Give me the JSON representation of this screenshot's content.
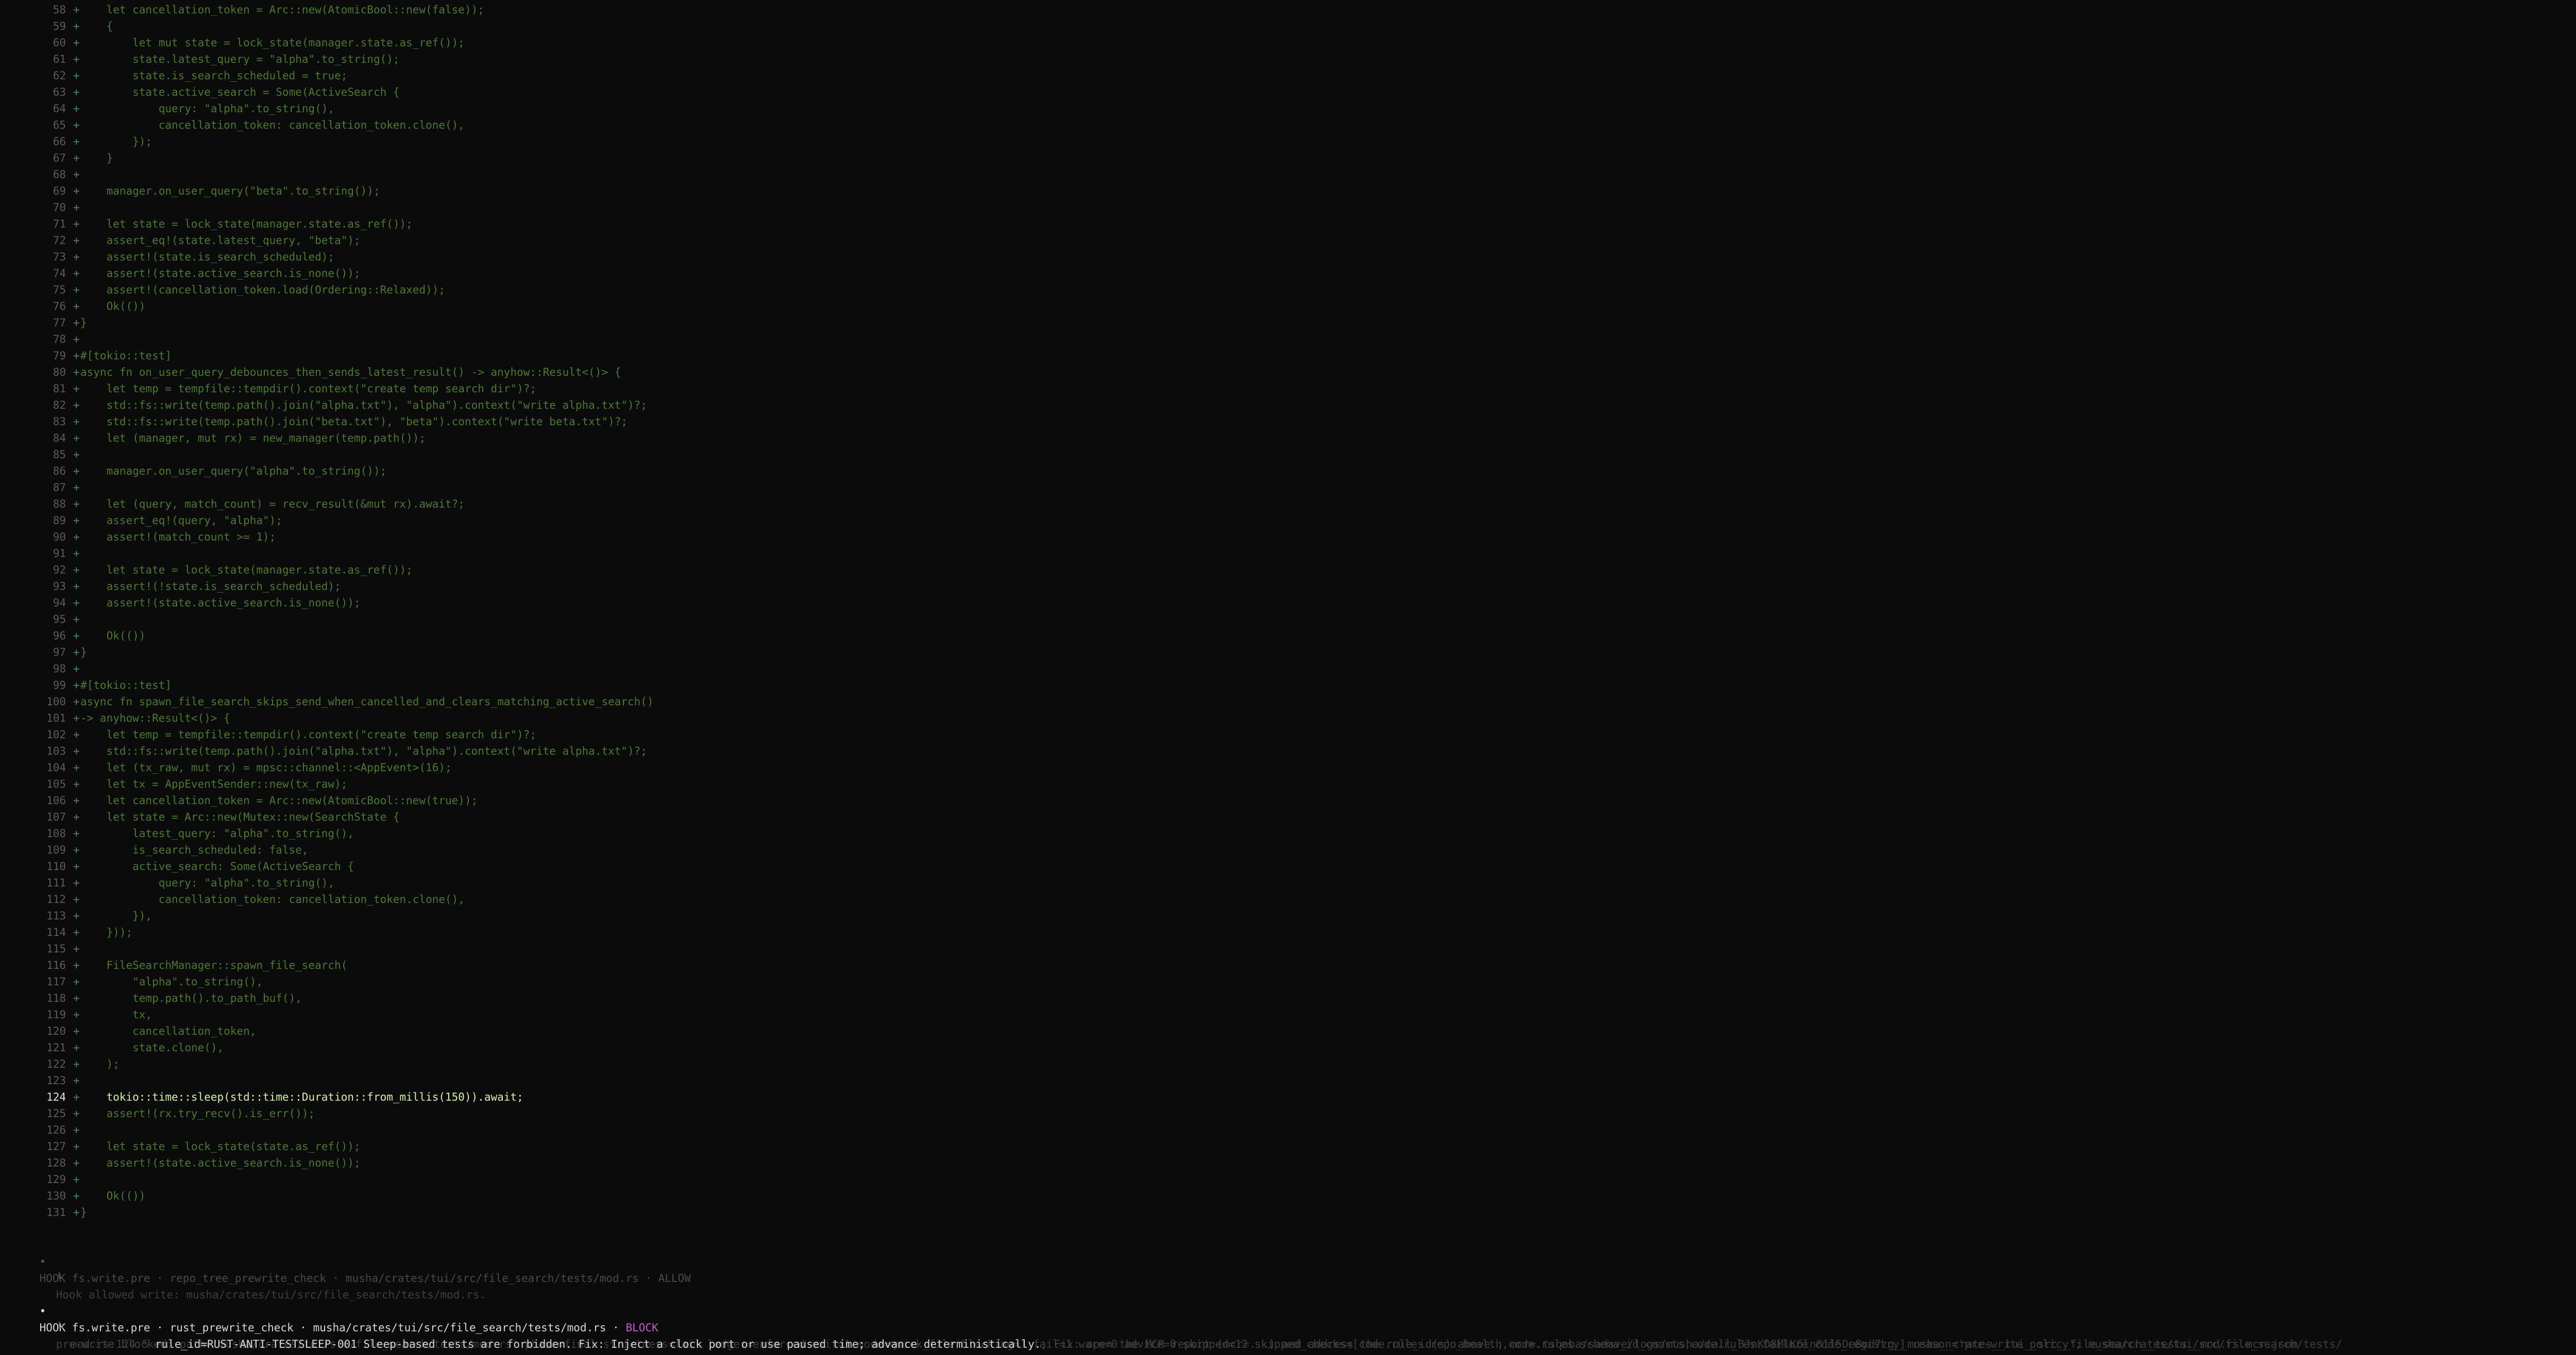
{
  "diff": {
    "lines": [
      {
        "n": "58",
        "m": "+",
        "t": "    let cancellation_token = Arc::new(AtomicBool::new(false));"
      },
      {
        "n": "59",
        "m": "+",
        "t": "    {"
      },
      {
        "n": "60",
        "m": "+",
        "t": "        let mut state = lock_state(manager.state.as_ref());"
      },
      {
        "n": "61",
        "m": "+",
        "t": "        state.latest_query = \"alpha\".to_string();"
      },
      {
        "n": "62",
        "m": "+",
        "t": "        state.is_search_scheduled = true;"
      },
      {
        "n": "63",
        "m": "+",
        "t": "        state.active_search = Some(ActiveSearch {"
      },
      {
        "n": "64",
        "m": "+",
        "t": "            query: \"alpha\".to_string(),"
      },
      {
        "n": "65",
        "m": "+",
        "t": "            cancellation_token: cancellation_token.clone(),"
      },
      {
        "n": "66",
        "m": "+",
        "t": "        });"
      },
      {
        "n": "67",
        "m": "+",
        "t": "    }"
      },
      {
        "n": "68",
        "m": "+",
        "t": ""
      },
      {
        "n": "69",
        "m": "+",
        "t": "    manager.on_user_query(\"beta\".to_string());"
      },
      {
        "n": "70",
        "m": "+",
        "t": ""
      },
      {
        "n": "71",
        "m": "+",
        "t": "    let state = lock_state(manager.state.as_ref());"
      },
      {
        "n": "72",
        "m": "+",
        "t": "    assert_eq!(state.latest_query, \"beta\");"
      },
      {
        "n": "73",
        "m": "+",
        "t": "    assert!(state.is_search_scheduled);"
      },
      {
        "n": "74",
        "m": "+",
        "t": "    assert!(state.active_search.is_none());"
      },
      {
        "n": "75",
        "m": "+",
        "t": "    assert!(cancellation_token.load(Ordering::Relaxed));"
      },
      {
        "n": "76",
        "m": "+",
        "t": "    Ok(())"
      },
      {
        "n": "77",
        "m": "+",
        "t": "}"
      },
      {
        "n": "78",
        "m": "+",
        "t": ""
      },
      {
        "n": "79",
        "m": "+",
        "t": "#[tokio::test]"
      },
      {
        "n": "80",
        "m": "+",
        "t": "async fn on_user_query_debounces_then_sends_latest_result() -> anyhow::Result<()> {"
      },
      {
        "n": "81",
        "m": "+",
        "t": "    let temp = tempfile::tempdir().context(\"create temp search dir\")?;"
      },
      {
        "n": "82",
        "m": "+",
        "t": "    std::fs::write(temp.path().join(\"alpha.txt\"), \"alpha\").context(\"write alpha.txt\")?;"
      },
      {
        "n": "83",
        "m": "+",
        "t": "    std::fs::write(temp.path().join(\"beta.txt\"), \"beta\").context(\"write beta.txt\")?;"
      },
      {
        "n": "84",
        "m": "+",
        "t": "    let (manager, mut rx) = new_manager(temp.path());"
      },
      {
        "n": "85",
        "m": "+",
        "t": ""
      },
      {
        "n": "86",
        "m": "+",
        "t": "    manager.on_user_query(\"alpha\".to_string());"
      },
      {
        "n": "87",
        "m": "+",
        "t": ""
      },
      {
        "n": "88",
        "m": "+",
        "t": "    let (query, match_count) = recv_result(&mut rx).await?;"
      },
      {
        "n": "89",
        "m": "+",
        "t": "    assert_eq!(query, \"alpha\");"
      },
      {
        "n": "90",
        "m": "+",
        "t": "    assert!(match_count >= 1);"
      },
      {
        "n": "91",
        "m": "+",
        "t": ""
      },
      {
        "n": "92",
        "m": "+",
        "t": "    let state = lock_state(manager.state.as_ref());"
      },
      {
        "n": "93",
        "m": "+",
        "t": "    assert!(!state.is_search_scheduled);"
      },
      {
        "n": "94",
        "m": "+",
        "t": "    assert!(state.active_search.is_none());"
      },
      {
        "n": "95",
        "m": "+",
        "t": ""
      },
      {
        "n": "96",
        "m": "+",
        "t": "    Ok(())"
      },
      {
        "n": "97",
        "m": "+",
        "t": "}"
      },
      {
        "n": "98",
        "m": "+",
        "t": ""
      },
      {
        "n": "99",
        "m": "+",
        "t": "#[tokio::test]"
      },
      {
        "n": "100",
        "m": "+",
        "t": "async fn spawn_file_search_skips_send_when_cancelled_and_clears_matching_active_search()"
      },
      {
        "n": "101",
        "m": "+",
        "t": "-> anyhow::Result<()> {"
      },
      {
        "n": "102",
        "m": "+",
        "t": "    let temp = tempfile::tempdir().context(\"create temp search dir\")?;"
      },
      {
        "n": "103",
        "m": "+",
        "t": "    std::fs::write(temp.path().join(\"alpha.txt\"), \"alpha\").context(\"write alpha.txt\")?;"
      },
      {
        "n": "104",
        "m": "+",
        "t": "    let (tx_raw, mut rx) = mpsc::channel::<AppEvent>(16);"
      },
      {
        "n": "105",
        "m": "+",
        "t": "    let tx = AppEventSender::new(tx_raw);"
      },
      {
        "n": "106",
        "m": "+",
        "t": "    let cancellation_token = Arc::new(AtomicBool::new(true));"
      },
      {
        "n": "107",
        "m": "+",
        "t": "    let state = Arc::new(Mutex::new(SearchState {"
      },
      {
        "n": "108",
        "m": "+",
        "t": "        latest_query: \"alpha\".to_string(),"
      },
      {
        "n": "109",
        "m": "+",
        "t": "        is_search_scheduled: false,"
      },
      {
        "n": "110",
        "m": "+",
        "t": "        active_search: Some(ActiveSearch {"
      },
      {
        "n": "111",
        "m": "+",
        "t": "            query: \"alpha\".to_string(),"
      },
      {
        "n": "112",
        "m": "+",
        "t": "            cancellation_token: cancellation_token.clone(),"
      },
      {
        "n": "113",
        "m": "+",
        "t": "        }),"
      },
      {
        "n": "114",
        "m": "+",
        "t": "    }));"
      },
      {
        "n": "115",
        "m": "+",
        "t": ""
      },
      {
        "n": "116",
        "m": "+",
        "t": "    FileSearchManager::spawn_file_search("
      },
      {
        "n": "117",
        "m": "+",
        "t": "        \"alpha\".to_string(),"
      },
      {
        "n": "118",
        "m": "+",
        "t": "        temp.path().to_path_buf(),"
      },
      {
        "n": "119",
        "m": "+",
        "t": "        tx,"
      },
      {
        "n": "120",
        "m": "+",
        "t": "        cancellation_token,"
      },
      {
        "n": "121",
        "m": "+",
        "t": "        state.clone(),"
      },
      {
        "n": "122",
        "m": "+",
        "t": "    );"
      },
      {
        "n": "123",
        "m": "+",
        "t": ""
      },
      {
        "n": "124",
        "m": "+",
        "t": "    tokio::time::sleep(std::time::Duration::from_millis(150)).await;"
      },
      {
        "n": "125",
        "m": "+",
        "t": "    assert!(rx.try_recv().is_err());"
      },
      {
        "n": "126",
        "m": "+",
        "t": ""
      },
      {
        "n": "127",
        "m": "+",
        "t": "    let state = lock_state(state.as_ref());"
      },
      {
        "n": "128",
        "m": "+",
        "t": "    assert!(state.active_search.is_none());"
      },
      {
        "n": "129",
        "m": "+",
        "t": ""
      },
      {
        "n": "130",
        "m": "+",
        "t": "    Ok(())"
      },
      {
        "n": "131",
        "m": "+",
        "t": "}"
      }
    ]
  },
  "hook_allow": {
    "bullet": "•",
    "text": "HOOK fs.write.pre · repo_tree_prewrite_check · musha/crates/tui/src/file_search/tests/mod.rs · ALLOW",
    "detail_prefix": "└",
    "detail": "Hook allowed write: musha/crates/tui/src/file_search/tests/mod.rs."
  },
  "hook_block": {
    "bullet": "•",
    "head": "HOOK fs.write.pre · rust_prewrite_check · musha/crates/tui/src/file_search/tests/mod.rs · ",
    "status": "BLOCK",
    "detail_prefix": "└",
    "detail1": "pre-write blocked: path='musha/crates/tui/src/file_search/tests/mod.rs' phase=final strictness=fail ledger=enforced exit=1 mode=quick_file blocking=1 fail=1 warn=0 advice=0 skipped=12 skipped_checks=[code.rules.repo_health,code.rules.schema_id_consts,code.rules.failure_code_registry] reason='pre-write policy'; musha/crates/tui/src/file_search/tests/",
    "detail2_dim": "mod.rs:124:5 ",
    "detail2_bright": "rule_id=RUST-ANTI-TESTSLEEP-001 Sleep-based tests are forbidden. Fix: Inject a clock port or use paused time; advance deterministically.",
    "detail2_tail": "; Fix: open the MCR report (mcr=...) and address the rule_id(s) above.; mcr=.tsqoba/sadave/logs/musha/call_BJnKD8MlK6ln81l5De8od7zg__musha__crates__tui__src__file_search__tests__mod.rs.mcr.json"
  }
}
